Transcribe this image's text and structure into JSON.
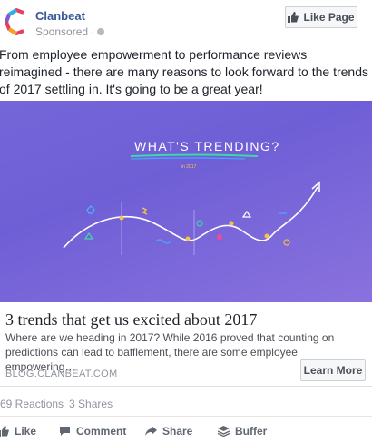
{
  "post": {
    "page_name": "Clanbeat",
    "sponsored_label": "Sponsored ·",
    "like_page_label": "Like Page",
    "text": "From employee empowerment to performance reviews reimagined - there are many reasons to look forward to the trends of 2017 settling in. It's going to be a great year!"
  },
  "hero": {
    "headline": "WHAT'S TRENDING?",
    "sub": "in 2017"
  },
  "link": {
    "title": "3 trends that get us excited about 2017",
    "description": "Where are we heading in 2017? While 2016 proved that counting on predictions can lead to bafflement, there are some employee empowering…",
    "domain": "BLOG.CLANBEAT.COM",
    "cta_label": "Learn More"
  },
  "stats": {
    "reactions": "69 Reactions",
    "shares": "3 Shares"
  },
  "actions": [
    {
      "label": "Like",
      "icon": "thumbs-up-icon"
    },
    {
      "label": "Comment",
      "icon": "comment-icon"
    },
    {
      "label": "Share",
      "icon": "share-icon"
    },
    {
      "label": "Buffer",
      "icon": "buffer-icon"
    }
  ],
  "colors": {
    "brand_link": "#365899",
    "hero_bg": "#7466d9",
    "secondary_text": "#90949c"
  }
}
